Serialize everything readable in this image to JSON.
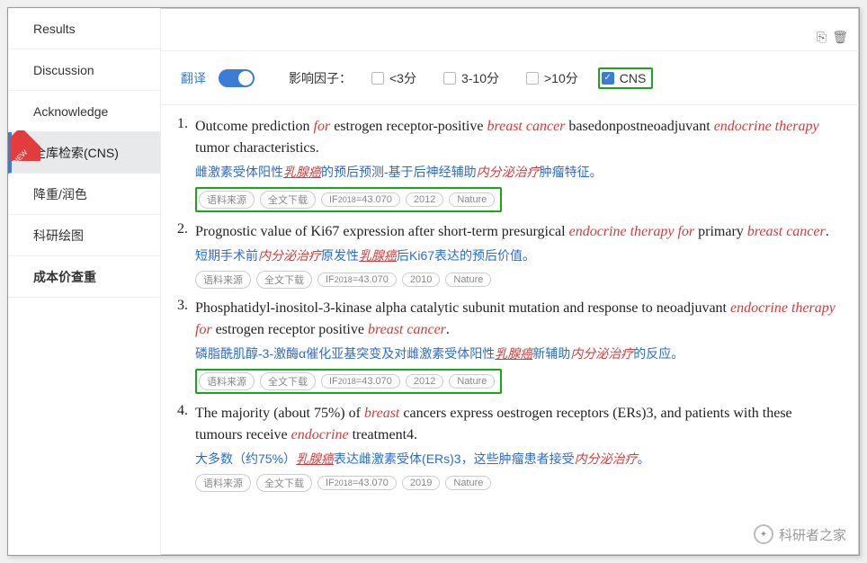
{
  "sidebar": {
    "items": [
      {
        "label": "Results"
      },
      {
        "label": "Discussion"
      },
      {
        "label": "Acknowledge"
      },
      {
        "label": "全库检索(CNS)",
        "active": true,
        "new": true
      },
      {
        "label": "降重/润色"
      },
      {
        "label": "科研绘图"
      },
      {
        "label": "成本价查重",
        "bold": true
      }
    ],
    "new_ribbon": "NEW"
  },
  "toolbar": {
    "copy_icon": "⎘",
    "delete_icon": "🗑"
  },
  "filters": {
    "translate_label": "翻译",
    "if_label": "影响因子：",
    "opt_lt3": "<3分",
    "opt_3_10": "3-10分",
    "opt_gt10": ">10分",
    "opt_cns": "CNS"
  },
  "badges": {
    "source": "语料来源",
    "fulltext": "全文下载",
    "if_prefix": "IF",
    "if_year": "2018",
    "if_eq": "=43.070",
    "journal": "Nature"
  },
  "results": [
    {
      "num": "1.",
      "title_parts": [
        {
          "t": "Outcome prediction "
        },
        {
          "t": "for",
          "r": 1
        },
        {
          "t": " estrogen receptor-positive "
        },
        {
          "t": "breast cancer",
          "r": 1
        },
        {
          "t": " basedonpostneoadjuvant "
        },
        {
          "t": "endocrine therapy",
          "r": 1
        },
        {
          "t": " tumor characteristics."
        }
      ],
      "zh_parts": [
        {
          "t": "雌激素受体阳性"
        },
        {
          "t": "乳腺癌",
          "r": 1,
          "u": 1
        },
        {
          "t": "的预后预测-基于后神经辅助"
        },
        {
          "t": "内分泌治疗",
          "r": 1
        },
        {
          "t": "肿瘤特征。"
        }
      ],
      "year": "2012",
      "hl": true
    },
    {
      "num": "2.",
      "title_parts": [
        {
          "t": "Prognostic value of Ki67 expression after short-term presurgical "
        },
        {
          "t": "endocrine therapy for",
          "r": 1
        },
        {
          "t": " primary "
        },
        {
          "t": "breast cancer",
          "r": 1
        },
        {
          "t": "."
        }
      ],
      "zh_parts": [
        {
          "t": "短期手术前"
        },
        {
          "t": "内分泌治疗",
          "r": 1
        },
        {
          "t": "原发性"
        },
        {
          "t": "乳腺癌",
          "r": 1,
          "u": 1
        },
        {
          "t": "后Ki67表达的预后价值。"
        }
      ],
      "year": "2010",
      "hl": false
    },
    {
      "num": "3.",
      "title_parts": [
        {
          "t": "Phosphatidyl-inositol-3-kinase alpha catalytic subunit mutation and response to neoadjuvant "
        },
        {
          "t": "endocrine therapy for",
          "r": 1
        },
        {
          "t": " estrogen receptor positive "
        },
        {
          "t": "breast cancer",
          "r": 1
        },
        {
          "t": "."
        }
      ],
      "zh_parts": [
        {
          "t": "磷脂酰肌醇-3-激酶α催化亚基突变及对雌激素受体阳性"
        },
        {
          "t": "乳腺癌",
          "r": 1,
          "u": 1
        },
        {
          "t": "新辅助"
        },
        {
          "t": "内分泌治疗",
          "r": 1
        },
        {
          "t": "的反应。"
        }
      ],
      "year": "2012",
      "hl": true
    },
    {
      "num": "4.",
      "title_parts": [
        {
          "t": "The majority (about 75%) of "
        },
        {
          "t": "breast",
          "r": 1
        },
        {
          "t": " cancers express oestrogen receptors (ERs)3, and patients with these tumours receive "
        },
        {
          "t": "endocrine",
          "r": 1
        },
        {
          "t": " treatment4."
        }
      ],
      "zh_parts": [
        {
          "t": "大多数（约75%）"
        },
        {
          "t": "乳腺癌",
          "r": 1,
          "u": 1
        },
        {
          "t": "表达雌激素受体(ERs)3，这些肿瘤患者接受"
        },
        {
          "t": "内分泌治疗",
          "r": 1
        },
        {
          "t": "。"
        }
      ],
      "year": "2019",
      "hl": false
    }
  ],
  "watermark": {
    "text": "科研者之家"
  }
}
